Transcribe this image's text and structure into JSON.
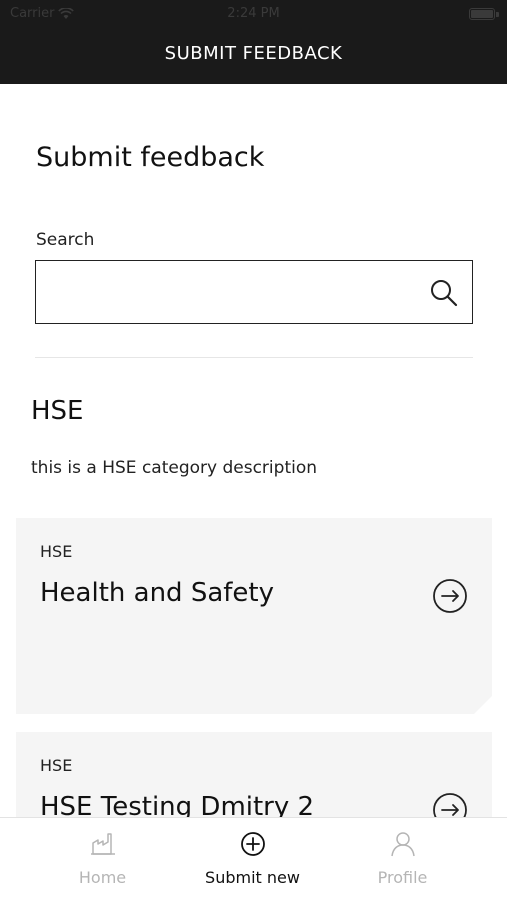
{
  "status_bar": {
    "carrier": "Carrier",
    "time": "2:24 PM"
  },
  "nav": {
    "title": "SUBMIT FEEDBACK"
  },
  "page": {
    "title": "Submit feedback"
  },
  "search": {
    "label": "Search",
    "value": "",
    "placeholder": ""
  },
  "section": {
    "title": "HSE",
    "description": "this is a HSE category description"
  },
  "cards": [
    {
      "tag": "HSE",
      "title": "Health and Safety"
    },
    {
      "tag": "HSE",
      "title": "HSE Testing Dmitry 2"
    }
  ],
  "tabbar": {
    "items": [
      {
        "label": "Home",
        "icon": "home-icon"
      },
      {
        "label": "Submit new",
        "icon": "plus-circle-icon"
      },
      {
        "label": "Profile",
        "icon": "user-icon"
      }
    ]
  },
  "colors": {
    "header_bg": "#1a1a1a",
    "card_bg": "#f5f5f5",
    "inactive_tab": "#b5b5b5"
  }
}
